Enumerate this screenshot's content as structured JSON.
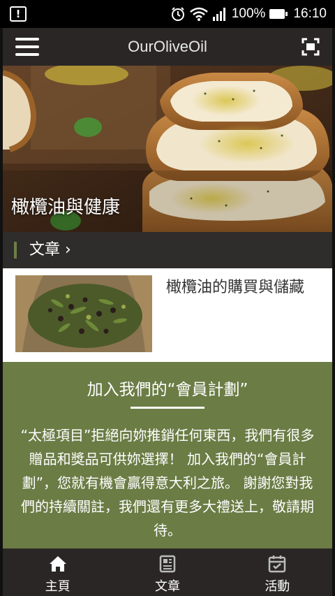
{
  "status_bar": {
    "alert_icon": "alert-icon",
    "battery": "100%",
    "time": "16:10"
  },
  "app_bar": {
    "title": "OurOliveOil",
    "menu_icon": "hamburger-menu-icon",
    "scan_icon": "scan-icon"
  },
  "hero": {
    "title": "橄欖油與健康"
  },
  "section": {
    "title": "文章 ›",
    "accent": "#6c7f44"
  },
  "article": {
    "title": "橄欖油的購買與儲藏"
  },
  "membership": {
    "title": "加入我們的“會員計劃”",
    "body": "“太極項目”拒絕向妳推銷任何東西，我們有很多贈品和獎品可供妳選擇！ 加入我們的“會員計劃”，您就有機會贏得意大利之旅。 謝謝您對我們的持續關註，我們還有更多大禮送上，敬請期待。",
    "background": "#6b7c45"
  },
  "bottom_nav": {
    "items": [
      {
        "label": "主頁",
        "icon": "home-icon"
      },
      {
        "label": "文章",
        "icon": "article-icon"
      },
      {
        "label": "活動",
        "icon": "calendar-icon"
      }
    ]
  }
}
